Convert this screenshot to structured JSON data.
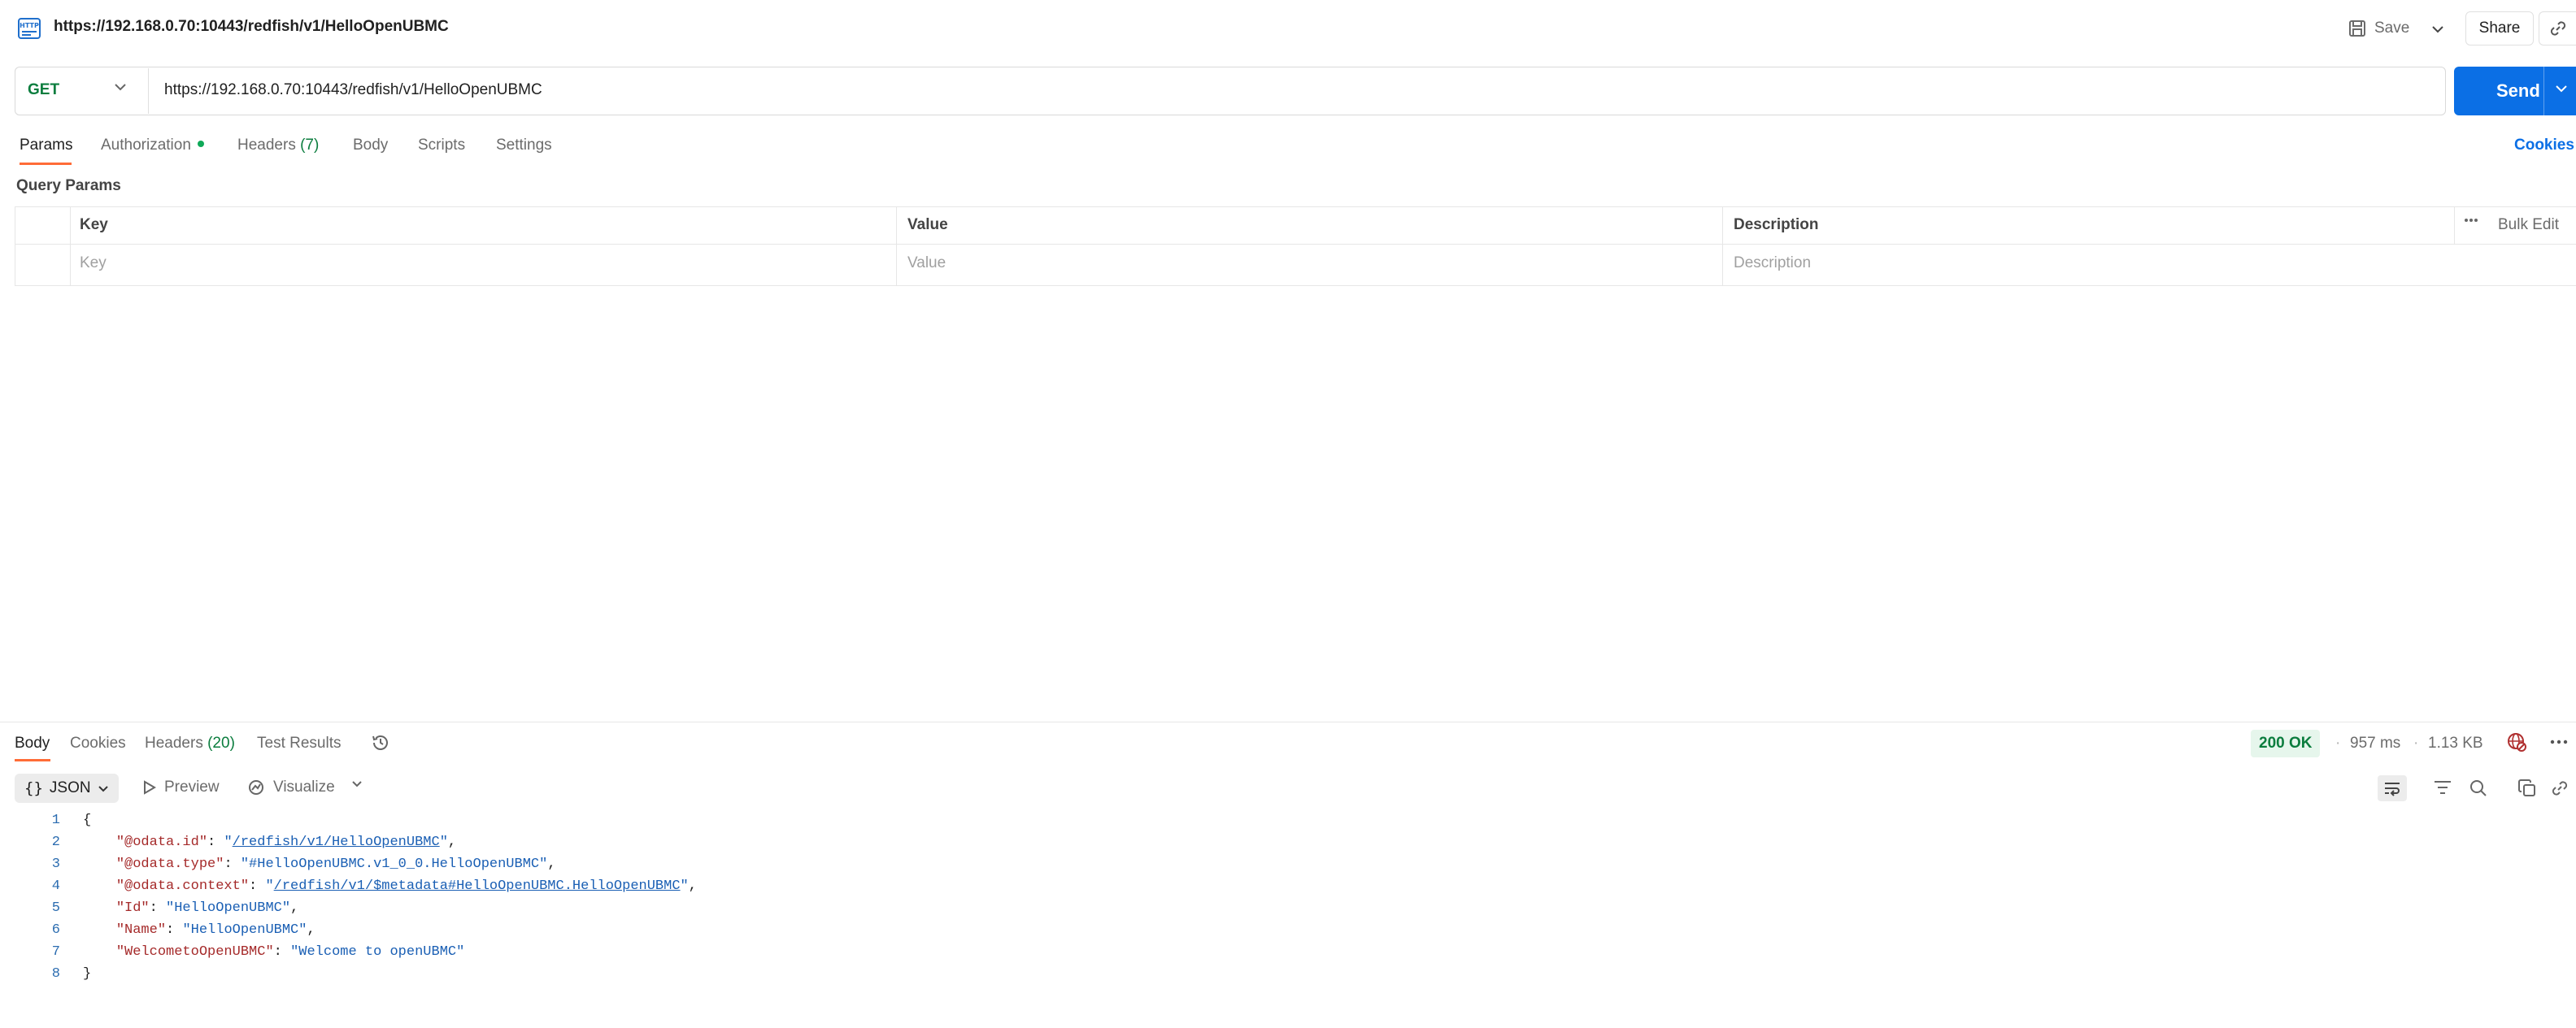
{
  "request": {
    "title": "https://192.168.0.70:10443/redfish/v1/HelloOpenUBMC",
    "method": "GET",
    "url": "https://192.168.0.70:10443/redfish/v1/HelloOpenUBMC"
  },
  "toolbar": {
    "save_label": "Save",
    "share_label": "Share",
    "send_label": "Send"
  },
  "request_tabs": {
    "params": "Params",
    "authorization": "Authorization",
    "headers": "Headers",
    "headers_count": "(7)",
    "body": "Body",
    "scripts": "Scripts",
    "settings": "Settings",
    "cookies": "Cookies"
  },
  "query_params": {
    "label": "Query Params",
    "columns": {
      "key": "Key",
      "value": "Value",
      "description": "Description"
    },
    "bulk_edit": "Bulk Edit",
    "placeholders": {
      "key": "Key",
      "value": "Value",
      "description": "Description"
    }
  },
  "response": {
    "tabs": {
      "body": "Body",
      "cookies": "Cookies",
      "headers": "Headers",
      "headers_count": "(20)",
      "test_results": "Test Results"
    },
    "status": "200 OK",
    "time": "957 ms",
    "size": "1.13 KB",
    "format": "JSON",
    "preview": "Preview",
    "visualize": "Visualize",
    "code_lines": [
      {
        "n": "1",
        "segments": [
          {
            "t": "{",
            "c": "p"
          }
        ]
      },
      {
        "n": "2",
        "segments": [
          {
            "t": "    ",
            "c": "p"
          },
          {
            "t": "\"@odata.id\"",
            "c": "k"
          },
          {
            "t": ": ",
            "c": "p"
          },
          {
            "t": "\"",
            "c": "s"
          },
          {
            "t": "/redfish/v1/HelloOpenUBMC",
            "c": "u"
          },
          {
            "t": "\"",
            "c": "s"
          },
          {
            "t": ",",
            "c": "p"
          }
        ]
      },
      {
        "n": "3",
        "segments": [
          {
            "t": "    ",
            "c": "p"
          },
          {
            "t": "\"@odata.type\"",
            "c": "k"
          },
          {
            "t": ": ",
            "c": "p"
          },
          {
            "t": "\"#HelloOpenUBMC.v1_0_0.HelloOpenUBMC\"",
            "c": "s"
          },
          {
            "t": ",",
            "c": "p"
          }
        ]
      },
      {
        "n": "4",
        "segments": [
          {
            "t": "    ",
            "c": "p"
          },
          {
            "t": "\"@odata.context\"",
            "c": "k"
          },
          {
            "t": ": ",
            "c": "p"
          },
          {
            "t": "\"",
            "c": "s"
          },
          {
            "t": "/redfish/v1/$metadata#HelloOpenUBMC.HelloOpenUBMC",
            "c": "u"
          },
          {
            "t": "\"",
            "c": "s"
          },
          {
            "t": ",",
            "c": "p"
          }
        ]
      },
      {
        "n": "5",
        "segments": [
          {
            "t": "    ",
            "c": "p"
          },
          {
            "t": "\"Id\"",
            "c": "k"
          },
          {
            "t": ": ",
            "c": "p"
          },
          {
            "t": "\"HelloOpenUBMC\"",
            "c": "s"
          },
          {
            "t": ",",
            "c": "p"
          }
        ]
      },
      {
        "n": "6",
        "segments": [
          {
            "t": "    ",
            "c": "p"
          },
          {
            "t": "\"Name\"",
            "c": "k"
          },
          {
            "t": ": ",
            "c": "p"
          },
          {
            "t": "\"HelloOpenUBMC\"",
            "c": "s"
          },
          {
            "t": ",",
            "c": "p"
          }
        ]
      },
      {
        "n": "7",
        "segments": [
          {
            "t": "    ",
            "c": "p"
          },
          {
            "t": "\"WelcometoOpenUBMC\"",
            "c": "k"
          },
          {
            "t": ": ",
            "c": "p"
          },
          {
            "t": "\"Welcome to openUBMC\"",
            "c": "s"
          }
        ]
      },
      {
        "n": "8",
        "segments": [
          {
            "t": "}",
            "c": "p"
          }
        ]
      }
    ]
  },
  "colors": {
    "accent_orange": "#ff6c37",
    "send_blue": "#0b6fe5",
    "status_green": "#0b7d3e",
    "json_key": "#a52a2a",
    "json_string": "#1a5fb4"
  },
  "icons": [
    "http-icon",
    "save-icon",
    "chevron-down-icon",
    "link-icon",
    "history-icon",
    "globe-blocked-icon",
    "more-icon",
    "braces-icon",
    "play-icon",
    "visualize-icon",
    "wrap-lines-icon",
    "filter-icon",
    "search-icon",
    "copy-icon"
  ]
}
